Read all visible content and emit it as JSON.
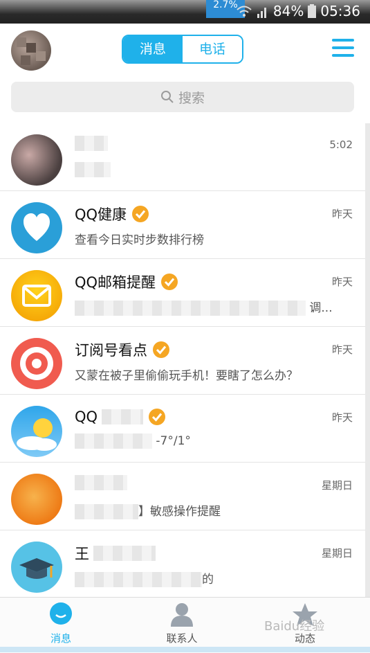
{
  "status": {
    "speed": "2.7%",
    "battery": "84%",
    "time": "05:36"
  },
  "header": {
    "tab_messages": "消息",
    "tab_phone": "电话"
  },
  "search": {
    "placeholder": "搜索"
  },
  "chats": [
    {
      "title": "",
      "message": "",
      "time": "5:02"
    },
    {
      "title": "QQ健康",
      "message": "查看今日实时步数排行榜",
      "time": "昨天"
    },
    {
      "title": "QQ邮箱提醒",
      "message": "调...",
      "time": "昨天"
    },
    {
      "title": "订阅号看点",
      "message": "又蒙在被子里偷偷玩手机！要瞎了怎么办？",
      "time": "昨天"
    },
    {
      "title": "QQ",
      "message": "-7°/1°",
      "time": "昨天"
    },
    {
      "title": "",
      "message": "】敏感操作提醒",
      "time": "星期日"
    },
    {
      "title": "王",
      "message": "的",
      "time": "星期日"
    }
  ],
  "tabbar": {
    "messages": "消息",
    "contacts": "联系人",
    "feeds": "动态"
  },
  "watermark": "Baidu经验",
  "colors": {
    "accent": "#1fb1ea",
    "verified": "#f5a623"
  }
}
